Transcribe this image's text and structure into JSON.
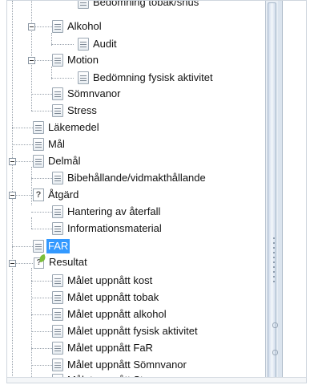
{
  "tree": {
    "items": [
      {
        "label": "Bedömning tobak/snus",
        "icon": "document-icon",
        "expander": "none"
      },
      {
        "label": "Alkohol",
        "icon": "document-icon",
        "expander": "collapse"
      },
      {
        "label": "Audit",
        "icon": "document-icon",
        "expander": "none"
      },
      {
        "label": "Motion",
        "icon": "document-icon",
        "expander": "collapse"
      },
      {
        "label": "Bedömning fysisk aktivitet",
        "icon": "document-icon",
        "expander": "none"
      },
      {
        "label": "Sömnvanor",
        "icon": "document-icon",
        "expander": "none"
      },
      {
        "label": "Stress",
        "icon": "document-icon",
        "expander": "none"
      },
      {
        "label": "Läkemedel",
        "icon": "document-icon",
        "expander": "none"
      },
      {
        "label": "Mål",
        "icon": "document-icon",
        "expander": "none"
      },
      {
        "label": "Delmål",
        "icon": "document-icon",
        "expander": "collapse"
      },
      {
        "label": "Bibehållande/vidmakthållande",
        "icon": "document-icon",
        "expander": "none"
      },
      {
        "label": "Åtgärd",
        "icon": "question-doc-icon",
        "expander": "collapse"
      },
      {
        "label": "Hantering av återfall",
        "icon": "document-icon",
        "expander": "none"
      },
      {
        "label": "Informationsmaterial",
        "icon": "document-icon",
        "expander": "none"
      },
      {
        "label": "FAR",
        "icon": "document-icon",
        "expander": "none",
        "selected": true
      },
      {
        "label": "Resultat",
        "icon": "result-icon",
        "expander": "collapse"
      },
      {
        "label": "Målet uppnått kost",
        "icon": "document-icon",
        "expander": "none"
      },
      {
        "label": "Målet uppnått tobak",
        "icon": "document-icon",
        "expander": "none"
      },
      {
        "label": "Målet uppnått alkohol",
        "icon": "document-icon",
        "expander": "none"
      },
      {
        "label": "Målet uppnått fysisk aktivitet",
        "icon": "document-icon",
        "expander": "none"
      },
      {
        "label": "Målet uppnått FaR",
        "icon": "document-icon",
        "expander": "none"
      },
      {
        "label": "Målet uppnått Sömnvanor",
        "icon": "document-icon",
        "expander": "none"
      },
      {
        "label": "Målet uppnått Stress",
        "icon": "document-icon",
        "expander": "none"
      }
    ],
    "icon_glyphs": {
      "question": "?"
    }
  },
  "colors": {
    "selection": "#3399ff",
    "guide_lines": "#9aa3ad",
    "scrollbar": "#e8eef5"
  }
}
